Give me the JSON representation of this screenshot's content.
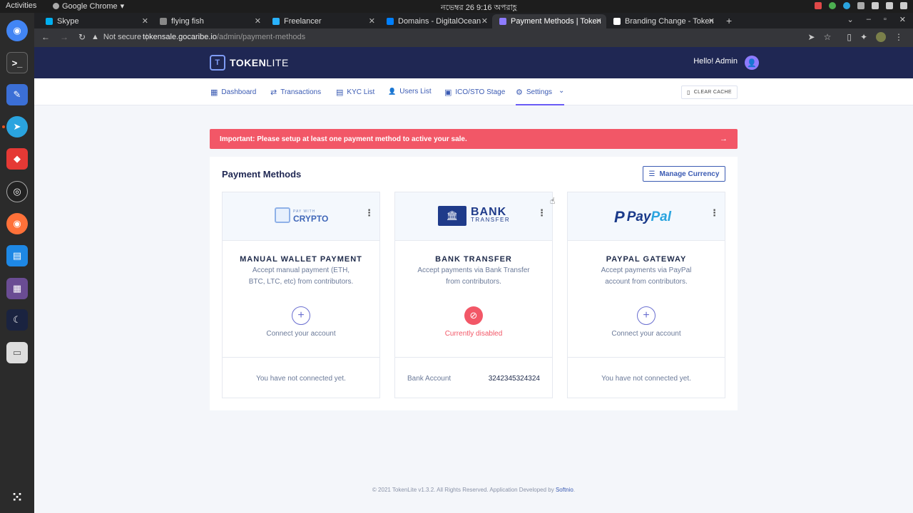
{
  "os": {
    "activities": "Activities",
    "app_name": "Google Chrome",
    "clock": "নভেম্বর 26  9:16 অপরাহ্ণ"
  },
  "browser": {
    "tabs": [
      {
        "label": "Skype",
        "color": "#00aff0"
      },
      {
        "label": "flying fish",
        "color": "#888888"
      },
      {
        "label": "Freelancer",
        "color": "#29b2fe"
      },
      {
        "label": "Domains - DigitalOcean",
        "color": "#0080ff"
      },
      {
        "label": "Payment Methods | Token",
        "color": "#8d7bff"
      },
      {
        "label": "Branding Change - Token",
        "color": "#ffffff"
      }
    ],
    "new_tab": "+",
    "security": "Not secure",
    "url_host": "tokensale.gocaribe.io",
    "url_path": "/admin/payment-methods"
  },
  "header": {
    "logo_token": "TOKEN",
    "logo_lite": "LITE",
    "greeting": "Hello! Admin"
  },
  "nav": {
    "items": [
      {
        "label": "Dashboard",
        "icon": "▦"
      },
      {
        "label": "Transactions",
        "icon": "⇄"
      },
      {
        "label": "KYC List",
        "icon": "▤"
      },
      {
        "label": "Users List",
        "icon": "👤"
      },
      {
        "label": "ICO/STO Stage",
        "icon": "▣"
      },
      {
        "label": "Settings",
        "icon": "⚙"
      }
    ],
    "settings_chevron": "⌄",
    "clear_cache": "CLEAR CACHE"
  },
  "alert": {
    "text": "Important: Please setup at least one payment method to active your sale.",
    "arrow": "→"
  },
  "panel": {
    "title": "Payment Methods",
    "manage_currency": "Manage Currency"
  },
  "cards": [
    {
      "logo_small": "PAY WITH",
      "logo_big": "CRYPTO",
      "title": "MANUAL WALLET PAYMENT",
      "desc": "Accept manual payment (ETH, BTC, LTC, etc) from contributors.",
      "status": "Connect your account",
      "footer": "You have not connected yet."
    },
    {
      "logo_big": "BANK",
      "logo_small": "TRANSFER",
      "title": "BANK TRANSFER",
      "desc": "Accept payments via Bank Transfer from contributors.",
      "status": "Currently disabled",
      "footer_label": "Bank Account",
      "footer_value": "3242345324324"
    },
    {
      "logo_pay": "Pay",
      "logo_pal": "Pal",
      "title": "PAYPAL GATEWAY",
      "desc": "Accept payments via PayPal account from contributors.",
      "status": "Connect your account",
      "footer": "You have not connected yet."
    }
  ],
  "footer": {
    "text": "© 2021 TokenLite v1.3.2. All Rights Reserved. Application Developed by ",
    "brand": "Softnio",
    "end": "."
  },
  "colors": {
    "header_bg": "#1f2753",
    "accent": "#3b5bb3",
    "alert": "#f25767"
  }
}
